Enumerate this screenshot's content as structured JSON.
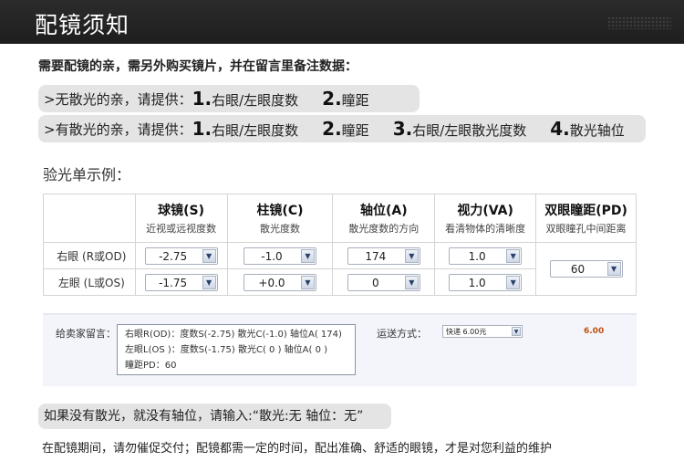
{
  "header": {
    "title": "配镜须知"
  },
  "intro": "需要配镜的亲，需另外购买镜片，并在留言里备注数据：",
  "no_astig": {
    "lead": ">无散光的亲，请提供：",
    "items": [
      {
        "num": "1.",
        "label": "右眼/左眼度数"
      },
      {
        "num": "2.",
        "label": "瞳距"
      }
    ]
  },
  "astig": {
    "lead": ">有散光的亲，请提供：",
    "items": [
      {
        "num": "1.",
        "label": "右眼/左眼度数"
      },
      {
        "num": "2.",
        "label": "瞳距"
      },
      {
        "num": "3.",
        "label": "右眼/左眼散光度数"
      },
      {
        "num": "4.",
        "label": "散光轴位"
      }
    ]
  },
  "example_title": "验光单示例：",
  "table": {
    "columns": [
      {
        "name": "球镜(S)",
        "sub": "近视或远视度数"
      },
      {
        "name": "柱镜(C)",
        "sub": "散光度数"
      },
      {
        "name": "轴位(A)",
        "sub": "散光度数的方向"
      },
      {
        "name": "视力(VA)",
        "sub": "看清物体的清晰度"
      },
      {
        "name": "双眼瞳距(PD)",
        "sub": "双眼瞳孔中间距离"
      }
    ],
    "rows": [
      {
        "label": "右眼 (R或OD)",
        "sphere": "-2.75",
        "cyl": "-1.0",
        "axis": "174",
        "va": "1.0"
      },
      {
        "label": "左眼 (L或OS)",
        "sphere": "-1.75",
        "cyl": "+0.0",
        "axis": "0",
        "va": "1.0"
      }
    ],
    "pd": "60"
  },
  "order": {
    "seller_label": "给卖家留言：",
    "note_lines": [
      "右眼R(OD)：度数S(-2.75)   散光C(-1.0)   轴位A( 174)",
      "左眼L(OS )：度数S(-1.75)   散光C( 0 )     轴位A( 0 )",
      "瞳距PD：60"
    ],
    "shipping_label": "运送方式：",
    "shipping_value": "快递 6.00元",
    "fee": "6.00"
  },
  "no_astig_note": "如果没有散光，就没有轴位，请输入:“散光:无    轴位：无”",
  "footer": "在配镜期间，请勿催促交付；配镜都需一定的时间，配出准确、舒适的眼镜，才是对您利益的维护",
  "colors": {
    "header_bg": "#222222",
    "pill_bg": "#e4e4e4",
    "fee": "#c05010"
  }
}
